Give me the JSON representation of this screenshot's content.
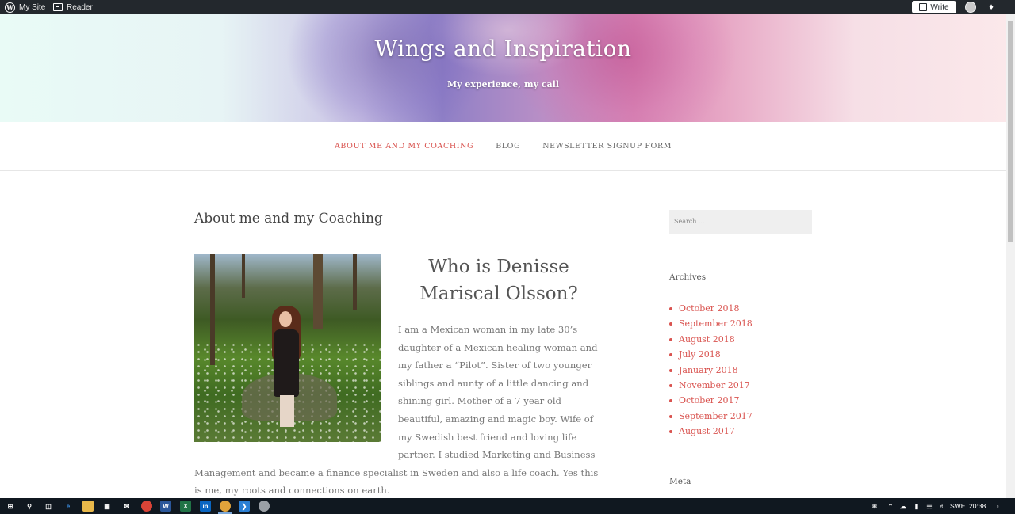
{
  "admin_bar": {
    "my_site": "My Site",
    "reader": "Reader",
    "write": "Write"
  },
  "header": {
    "site_title": "Wings and Inspiration",
    "site_description": "My experience, my call"
  },
  "nav": {
    "items": [
      {
        "label": "ABOUT ME AND MY COACHING",
        "current": true
      },
      {
        "label": "BLOG",
        "current": false
      },
      {
        "label": "NEWSLETTER SIGNUP FORM",
        "current": false
      }
    ]
  },
  "main": {
    "page_title": "About me and my Coaching",
    "post_heading": "Who is Denisse Mariscal Olsson?",
    "post_text": "I am a Mexican woman in my late 30’s daughter of a Mexican healing woman and my father a “Pilot”. Sister of two younger siblings and aunty of a little dancing and shining girl. Mother of a 7 year old beautiful, amazing and magic boy. Wife of my Swedish best friend and loving life partner. I studied Marketing and Business Management and became a finance specialist in Sweden and also a life coach. Yes this is me, my roots and connections on earth."
  },
  "sidebar": {
    "search_placeholder": "Search ...",
    "archives_title": "Archives",
    "archives": [
      "October 2018",
      "September 2018",
      "August 2018",
      "July 2018",
      "January 2018",
      "November 2017",
      "October 2017",
      "September 2017",
      "August 2017"
    ],
    "meta_title": "Meta"
  },
  "taskbar": {
    "language": "SWE",
    "time": "20:38"
  },
  "colors": {
    "accent": "#d9534f",
    "admin_bar": "#23282d",
    "taskbar": "#101820"
  }
}
